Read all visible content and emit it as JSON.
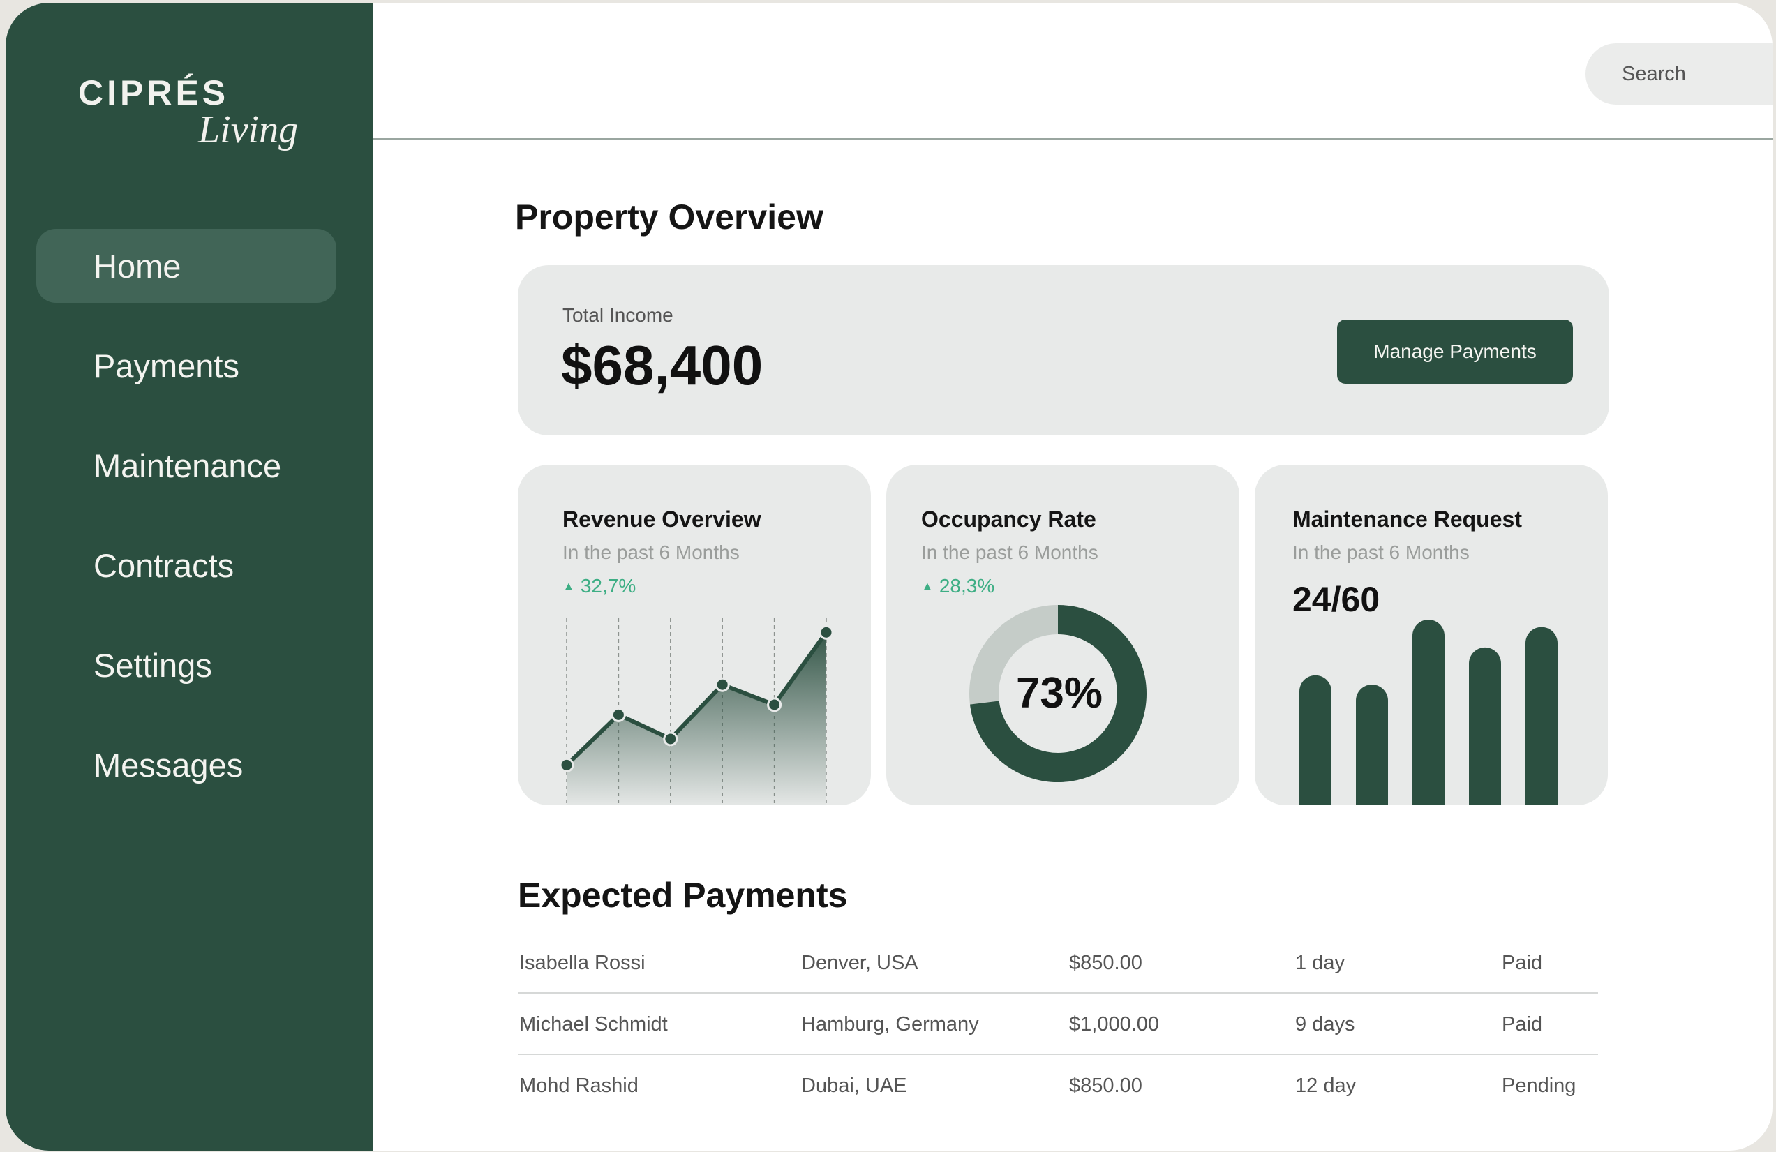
{
  "brand": {
    "name": "CIPRÉS",
    "tagline": "Living"
  },
  "sidebar": {
    "items": [
      {
        "label": "Home",
        "active": true
      },
      {
        "label": "Payments"
      },
      {
        "label": "Maintenance"
      },
      {
        "label": "Contracts"
      },
      {
        "label": "Settings"
      },
      {
        "label": "Messages"
      }
    ]
  },
  "header": {
    "search_placeholder": "Search",
    "notification_icon": "bell-icon",
    "notification_badge_color": "#e03c3c",
    "avatar_icon": "user-icon"
  },
  "overview": {
    "title": "Property Overview",
    "income_label": "Total Income",
    "income_value": "$68,400",
    "manage_button": "Manage Payments"
  },
  "cards": {
    "revenue": {
      "title": "Revenue Overview",
      "subtitle": "In the past 6 Months",
      "trend": "32,7%"
    },
    "occupancy": {
      "title": "Occupancy Rate",
      "subtitle": "In the past 6 Months",
      "trend": "28,3%",
      "value_label": "73%"
    },
    "maintenance": {
      "title": "Maintenance Request",
      "subtitle": "In the past 6 Months",
      "count": "24/60"
    }
  },
  "chart_data": [
    {
      "type": "line",
      "values": [
        20,
        45,
        33,
        60,
        50,
        86
      ],
      "ylim": [
        0,
        100
      ]
    },
    {
      "type": "pie",
      "values": [
        73,
        27
      ]
    },
    {
      "type": "bar",
      "values": [
        70,
        65,
        100,
        85,
        96
      ],
      "ylim": [
        0,
        100
      ]
    }
  ],
  "payments": {
    "title": "Expected Payments",
    "rows": [
      [
        "Isabella Rossi",
        "Denver, USA",
        "$850.00",
        "1 day",
        "Paid"
      ],
      [
        "Michael Schmidt",
        "Hamburg, Germany",
        "$1,000.00",
        "9 days",
        "Paid"
      ],
      [
        "Mohd Rashid",
        "Dubai, UAE",
        "$850.00",
        "12 day",
        "Pending"
      ]
    ]
  },
  "colors": {
    "primary": "#2b4f40",
    "accent_green": "#3dae84",
    "surface": "#e8eae9"
  }
}
